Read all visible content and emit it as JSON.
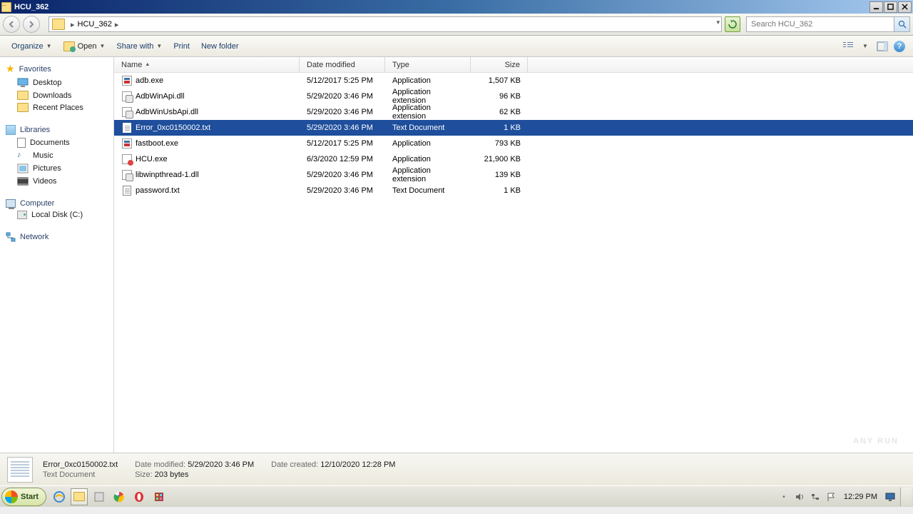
{
  "window": {
    "title": "HCU_362"
  },
  "address": {
    "crumb0": "",
    "crumb1": "HCU_362"
  },
  "search": {
    "placeholder": "Search HCU_362"
  },
  "toolbar": {
    "organize": "Organize",
    "open": "Open",
    "share": "Share with",
    "print": "Print",
    "newfolder": "New folder"
  },
  "sidebar": {
    "favorites": {
      "hdr": "Favorites",
      "items": [
        "Desktop",
        "Downloads",
        "Recent Places"
      ]
    },
    "libraries": {
      "hdr": "Libraries",
      "items": [
        "Documents",
        "Music",
        "Pictures",
        "Videos"
      ]
    },
    "computer": {
      "hdr": "Computer",
      "items": [
        "Local Disk (C:)"
      ]
    },
    "network": {
      "hdr": "Network"
    }
  },
  "columns": {
    "name": "Name",
    "date": "Date modified",
    "type": "Type",
    "size": "Size"
  },
  "files": [
    {
      "name": "adb.exe",
      "date": "5/12/2017 5:25 PM",
      "type": "Application",
      "size": "1,507 KB",
      "icon": "exe",
      "selected": false
    },
    {
      "name": "AdbWinApi.dll",
      "date": "5/29/2020 3:46 PM",
      "type": "Application extension",
      "size": "96 KB",
      "icon": "dll",
      "selected": false
    },
    {
      "name": "AdbWinUsbApi.dll",
      "date": "5/29/2020 3:46 PM",
      "type": "Application extension",
      "size": "62 KB",
      "icon": "dll",
      "selected": false
    },
    {
      "name": "Error_0xc0150002.txt",
      "date": "5/29/2020 3:46 PM",
      "type": "Text Document",
      "size": "1 KB",
      "icon": "txt",
      "selected": true
    },
    {
      "name": "fastboot.exe",
      "date": "5/12/2017 5:25 PM",
      "type": "Application",
      "size": "793 KB",
      "icon": "exe",
      "selected": false
    },
    {
      "name": "HCU.exe",
      "date": "6/3/2020 12:59 PM",
      "type": "Application",
      "size": "21,900 KB",
      "icon": "hcu",
      "selected": false
    },
    {
      "name": "libwinpthread-1.dll",
      "date": "5/29/2020 3:46 PM",
      "type": "Application extension",
      "size": "139 KB",
      "icon": "dll",
      "selected": false
    },
    {
      "name": "password.txt",
      "date": "5/29/2020 3:46 PM",
      "type": "Text Document",
      "size": "1 KB",
      "icon": "txt",
      "selected": false
    }
  ],
  "details": {
    "name": "Error_0xc0150002.txt",
    "type": "Text Document",
    "modified_lbl": "Date modified:",
    "modified": "5/29/2020 3:46 PM",
    "created_lbl": "Date created:",
    "created": "12/10/2020 12:28 PM",
    "size_lbl": "Size:",
    "size": "203 bytes"
  },
  "taskbar": {
    "start": "Start",
    "clock": "12:29 PM"
  },
  "watermark": "ANY    RUN"
}
